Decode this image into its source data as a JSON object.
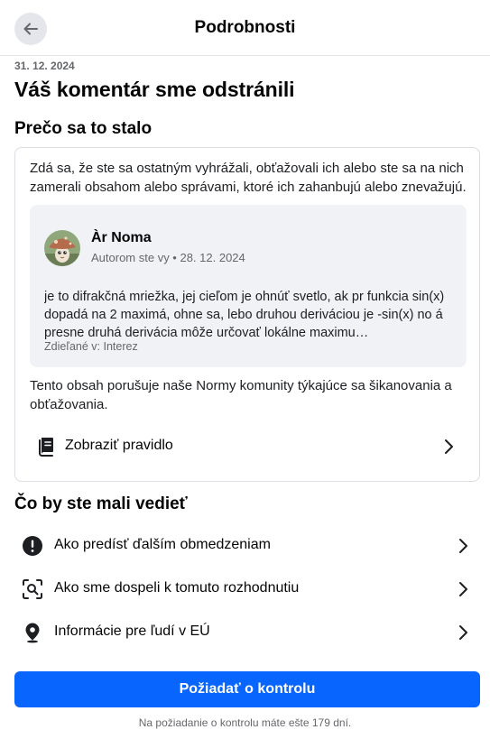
{
  "header": {
    "title": "Podrobnosti",
    "back_icon": "arrow-left-icon"
  },
  "date": "31. 12. 2024",
  "title": "Váš komentár sme odstránili",
  "why": {
    "heading": "Prečo sa to stalo",
    "intro": "Zdá sa, že ste sa ostatným vyhrážali, obťažovali ich alebo ste sa na nich zamerali obsahom alebo správami, ktoré ich zahanbujú alebo znevažujú.",
    "comment": {
      "author": "Àr Noma",
      "meta": "Autorom ste vy • 28. 12. 2024",
      "text": "je to difrakčná mriežka, jej cieľom je ohnúť svetlo, ak pr funkcia sin(x) dopadá na 2 maximá, ohne sa, lebo druhou deriváciou je -sin(x) no á presne druhá derivácia môže určovať lokálne maximu…",
      "shared": "Zdieľané v: Interez"
    },
    "violation": "Tento obsah porušuje naše Normy komunity týkajúce sa šikanovania a obťažovania.",
    "rule_link": {
      "label": "Zobraziť pravidlo",
      "icon": "rulebook-icon"
    }
  },
  "know": {
    "heading": "Čo by ste mali vedieť",
    "items": [
      {
        "label": "Ako predísť ďalším obmedzeniam",
        "icon": "exclamation-circle-icon"
      },
      {
        "label": "Ako sme dospeli k tomuto rozhodnutiu",
        "icon": "scan-search-icon"
      },
      {
        "label": "Informácie pre ľudí v EÚ",
        "icon": "location-pin-icon"
      }
    ]
  },
  "cta": {
    "button": "Požiadať o kontrolu",
    "note": "Na požiadanie o kontrolu máte ešte 179 dní."
  },
  "colors": {
    "primary": "#0866ff",
    "secondary_text": "#65676b",
    "border": "#dadde1",
    "quote_bg": "#f0f2f5"
  }
}
